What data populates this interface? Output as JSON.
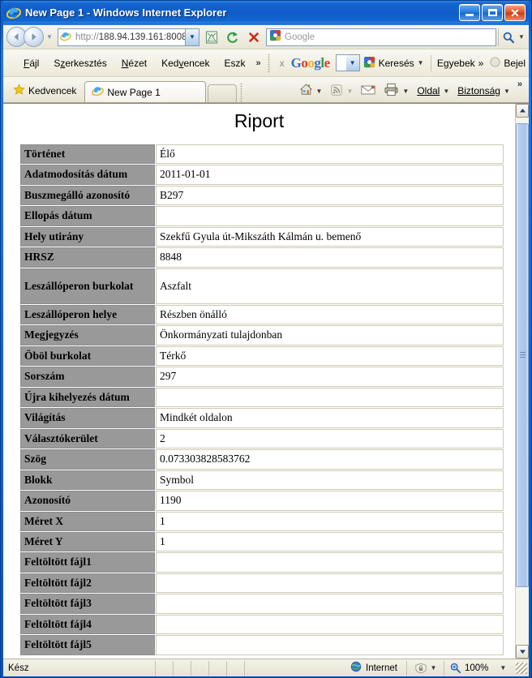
{
  "window": {
    "title": "New Page 1 - Windows Internet Explorer",
    "icon": "ie-logo-icon",
    "minimize_label": "",
    "maximize_label": "",
    "close_label": "✕"
  },
  "navigation": {
    "back_icon": "back-arrow-icon",
    "forward_icon": "forward-arrow-icon",
    "recent_pages_icon": "chevron-down-icon",
    "url_protocol": "http://",
    "url_rest": "188.94.139.161:8008",
    "url_full": "http://188.94.139.161:8008",
    "url_dropdown_icon": "chevron-down-icon",
    "compatibility_icon": "compatibility-view-icon",
    "refresh_icon": "refresh-icon",
    "stop_icon": "stop-icon",
    "search_placeholder": "Google",
    "search_value": "",
    "search_go_icon": "search-icon",
    "search_dropdown_icon": "chevron-down-icon"
  },
  "menubar": {
    "items": [
      {
        "label": "Fájl",
        "accel": "F"
      },
      {
        "label": "Szerkesztés",
        "accel": "z"
      },
      {
        "label": "Nézet",
        "accel": "N"
      },
      {
        "label": "Kedvencek",
        "accel": "v"
      },
      {
        "label": "Eszk",
        "accel": ""
      }
    ],
    "overflow_label": "»"
  },
  "google_toolbar": {
    "close_label": "x",
    "wordmark": {
      "g1": "G",
      "o1": "o",
      "o2": "o",
      "g2": "g",
      "l": "l",
      "e": "e"
    },
    "input_value": "",
    "input_dropdown_icon": "chevron-down-icon",
    "search_label": "Keresés",
    "search_icon": "google-g-icon",
    "more_label": "Egyebek",
    "more_icon": "double-chevron-right-icon",
    "signin_label": "Bejel",
    "signin_icon": "account-circle-icon"
  },
  "tabbar": {
    "favorites_label": "Kedvencek",
    "favorites_icon": "star-icon",
    "tabs": [
      {
        "label": "New Page 1",
        "icon": "ie-page-icon",
        "active": true
      }
    ],
    "new_tab_label": "",
    "commands": [
      {
        "label": "",
        "icon": "home-icon",
        "has_caret": true
      },
      {
        "label": "",
        "icon": "feeds-icon",
        "has_caret": true
      },
      {
        "label": "",
        "icon": "mail-icon",
        "has_caret": false
      },
      {
        "label": "",
        "icon": "print-icon",
        "has_caret": true
      },
      {
        "label": "Oldal",
        "icon": "",
        "has_caret": true
      },
      {
        "label": "Biztonság",
        "icon": "",
        "has_caret": true
      }
    ],
    "overflow_label": "»"
  },
  "page": {
    "heading": "Riport",
    "rows": [
      {
        "label": "Történet",
        "value": "Élő",
        "tall": false
      },
      {
        "label": "Adatmodosítás dátum",
        "value": "2011-01-01",
        "tall": false
      },
      {
        "label": "Buszmegálló azonosító",
        "value": "B297",
        "tall": false
      },
      {
        "label": "Ellopás dátum",
        "value": "",
        "tall": false
      },
      {
        "label": "Hely utirány",
        "value": "Szekfű Gyula út-Mikszáth Kálmán u. bemenő",
        "tall": false
      },
      {
        "label": "HRSZ",
        "value": "8848",
        "tall": false
      },
      {
        "label": "Leszállóperon burkolat",
        "value": "Aszfalt",
        "tall": true
      },
      {
        "label": "Leszállóperon helye",
        "value": "Részben önálló",
        "tall": false
      },
      {
        "label": "Megjegyzés",
        "value": "Önkormányzati tulajdonban",
        "tall": false
      },
      {
        "label": "Öböl burkolat",
        "value": "Térkő",
        "tall": false
      },
      {
        "label": "Sorszám",
        "value": "297",
        "tall": false
      },
      {
        "label": "Újra kihelyezés dátum",
        "value": "",
        "tall": false
      },
      {
        "label": "Világítás",
        "value": "Mindkét oldalon",
        "tall": false
      },
      {
        "label": "Választókerület",
        "value": "2",
        "tall": false
      },
      {
        "label": "Szög",
        "value": "0.073303828583762",
        "tall": false
      },
      {
        "label": "Blokk",
        "value": "Symbol",
        "tall": false
      },
      {
        "label": "Azonosító",
        "value": "1190",
        "tall": false
      },
      {
        "label": "Méret X",
        "value": "1",
        "tall": false
      },
      {
        "label": "Méret Y",
        "value": "1",
        "tall": false
      },
      {
        "label": "Feltöltött fájl1",
        "value": "",
        "tall": false
      },
      {
        "label": "Feltöltött fájl2",
        "value": "",
        "tall": false
      },
      {
        "label": "Feltöltött fájl3",
        "value": "",
        "tall": false
      },
      {
        "label": "Feltöltött fájl4",
        "value": "",
        "tall": false
      },
      {
        "label": "Feltöltött fájl5",
        "value": "",
        "tall": false
      }
    ]
  },
  "scrollbar": {
    "up_icon": "chevron-up-icon",
    "down_icon": "chevron-down-icon",
    "thumb_top_pct": 1,
    "thumb_height_pct": 88
  },
  "statusbar": {
    "status_text": "Kész",
    "zone_label": "Internet",
    "zone_icon": "globe-icon",
    "protected_icon": "protected-mode-icon",
    "protected_caret_icon": "chevron-down-icon",
    "zoom_label": "100%",
    "zoom_icon": "zoom-icon",
    "zoom_caret_icon": "chevron-down-icon"
  },
  "colors": {
    "title_blue": "#0d5cc8",
    "frame_blue": "#0a54b8",
    "chrome_beige": "#ece9d8",
    "label_gray": "#999999",
    "cell_border": "#cfcbb6",
    "accent_link": "#0000ee"
  }
}
